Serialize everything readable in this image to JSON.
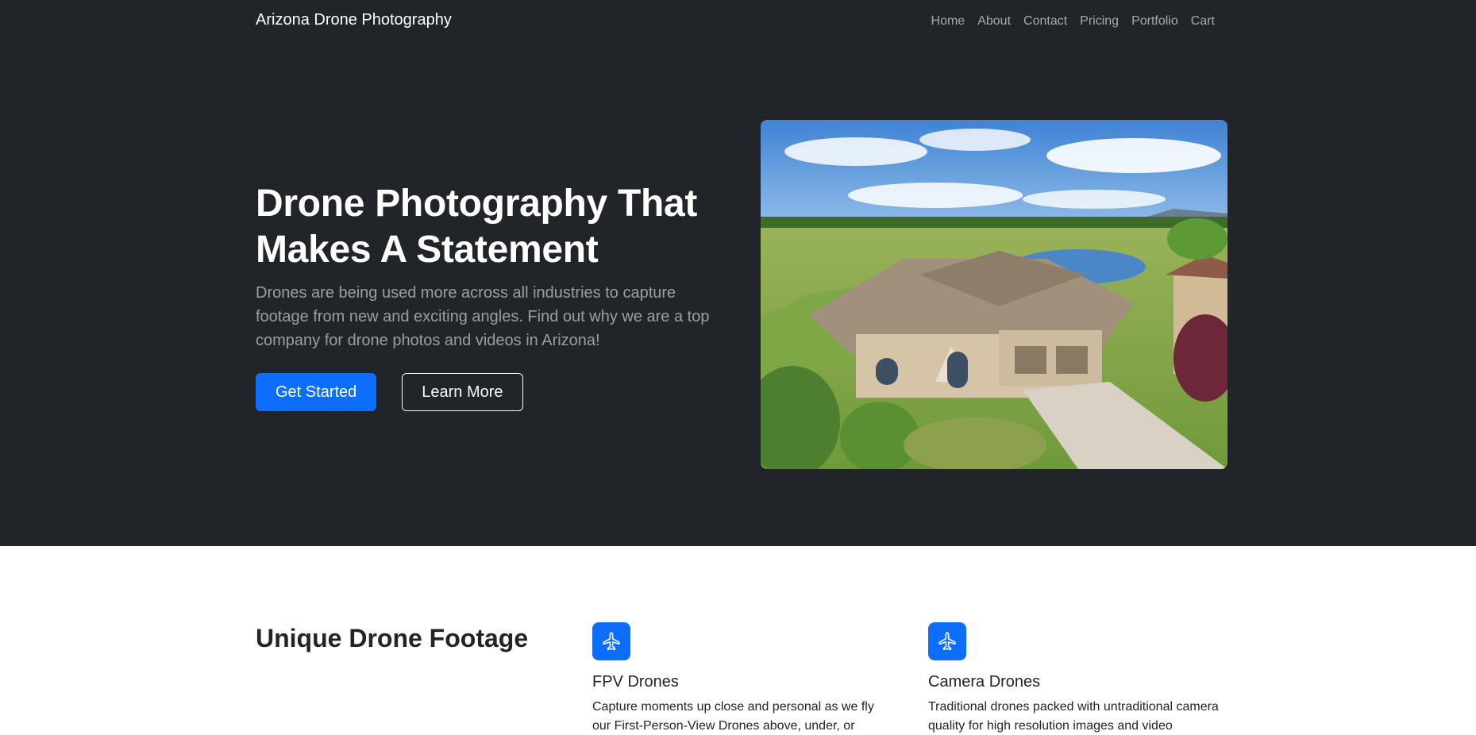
{
  "brand": "Arizona Drone Photography",
  "nav": [
    "Home",
    "About",
    "Contact",
    "Pricing",
    "Portfolio",
    "Cart"
  ],
  "hero": {
    "title": "Drone Photography That Makes A Statement",
    "lead": "Drones are being used more across all industries to capture footage from new and exciting angles. Find out why we are a top company for drone photos and videos in Arizona!",
    "primary_button": "Get Started",
    "secondary_button": "Learn More"
  },
  "features": {
    "title": "Unique Drone Footage",
    "items": [
      {
        "icon": "airplane-icon",
        "name": "FPV Drones",
        "desc": "Capture moments up close and personal as we fly our First-Person-View Drones above, under, or"
      },
      {
        "icon": "airplane-icon",
        "name": "Camera Drones",
        "desc": "Traditional drones packed with untraditional camera quality for high resolution images and video"
      }
    ]
  },
  "colors": {
    "dark": "#212529",
    "primary": "#0d6efd"
  }
}
